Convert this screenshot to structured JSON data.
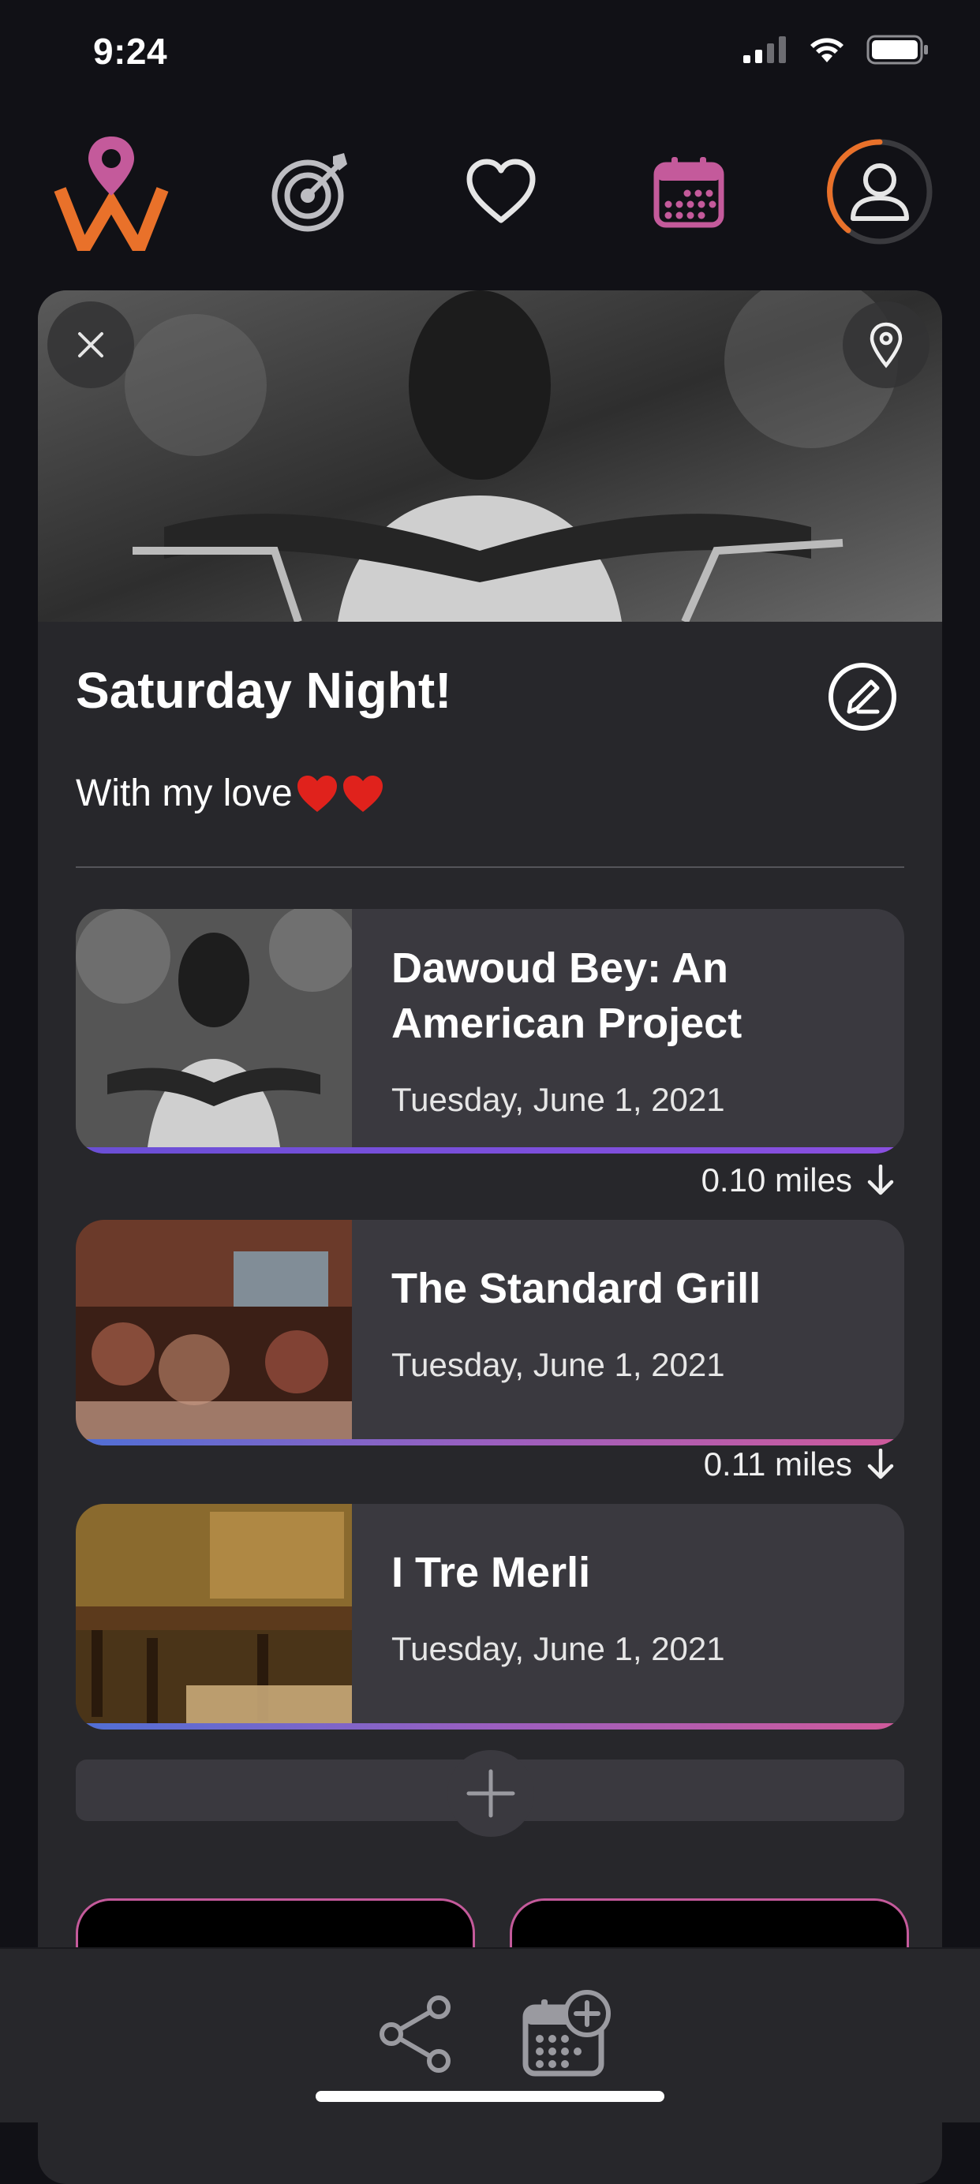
{
  "status_bar": {
    "time": "9:24"
  },
  "nav": {
    "items": [
      {
        "icon": "logo-icon"
      },
      {
        "icon": "target-icon"
      },
      {
        "icon": "heart-icon"
      },
      {
        "icon": "calendar-icon",
        "active": true
      },
      {
        "icon": "profile-icon"
      }
    ]
  },
  "plan": {
    "title": "Saturday Night!",
    "description": "With my love"
  },
  "items": [
    {
      "name": "Dawoud Bey: An American Project",
      "date": "Tuesday, June 1, 2021"
    },
    {
      "name": "The Standard Grill",
      "date": "Tuesday, June 1, 2021"
    },
    {
      "name": "I Tre Merli",
      "date": "Tuesday, June 1, 2021"
    }
  ],
  "distances": [
    "0.10 miles",
    "0.11 miles"
  ],
  "colors": {
    "accent_pink": "#c45a9b",
    "accent_orange": "#e9712a",
    "accent_purple": "#7b4fd6",
    "background": "#111116",
    "card": "#27272b",
    "item": "#3a393f"
  },
  "bottom_bar": {
    "icons": [
      "share-icon",
      "add-to-calendar-icon"
    ]
  }
}
